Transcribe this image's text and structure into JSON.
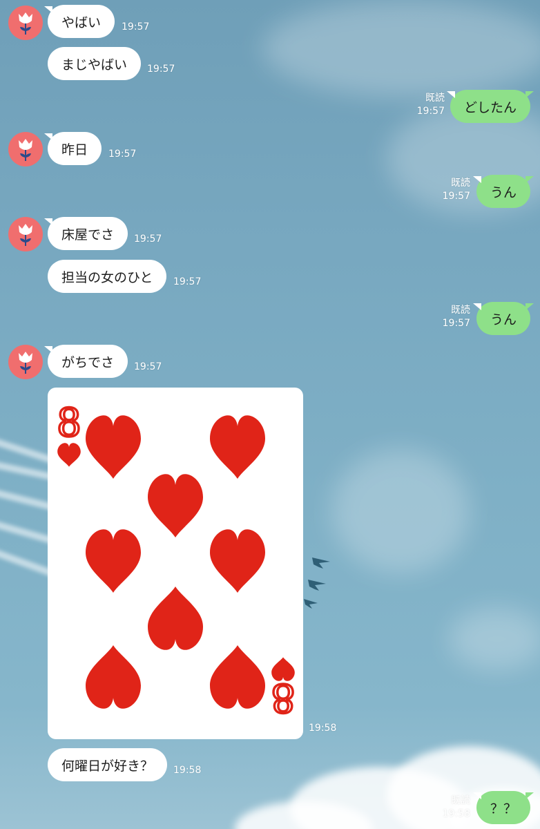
{
  "contact": {
    "avatar_icon": "red-tulip-icon"
  },
  "colors": {
    "incoming_bubble": "#ffffff",
    "outgoing_bubble": "#8ee089",
    "avatar_bg": "#f06e6e",
    "heart_red": "#e02418"
  },
  "messages": [
    {
      "from": "them",
      "text": "やばい",
      "time": "19:57"
    },
    {
      "from": "them",
      "text": "まじやばい",
      "time": "19:57"
    },
    {
      "from": "me",
      "text": "どしたん",
      "read": "既読",
      "time": "19:57"
    },
    {
      "from": "them",
      "text": "昨日",
      "time": "19:57"
    },
    {
      "from": "me",
      "text": "うん",
      "read": "既読",
      "time": "19:57"
    },
    {
      "from": "them",
      "text": "床屋でさ",
      "time": "19:57"
    },
    {
      "from": "them",
      "text": "担当の女のひと",
      "time": "19:57"
    },
    {
      "from": "me",
      "text": "うん",
      "read": "既読",
      "time": "19:57"
    },
    {
      "from": "them",
      "text": "がちでさ",
      "time": "19:57"
    },
    {
      "from": "them",
      "image": "playing-card-8-of-hearts",
      "card_rank": "8",
      "card_suit": "hearts",
      "time": "19:58"
    },
    {
      "from": "them",
      "text": "何曜日が好き？",
      "time": "19:58"
    },
    {
      "from": "me",
      "text": "？？",
      "read": "既読",
      "time": "19:58"
    }
  ]
}
